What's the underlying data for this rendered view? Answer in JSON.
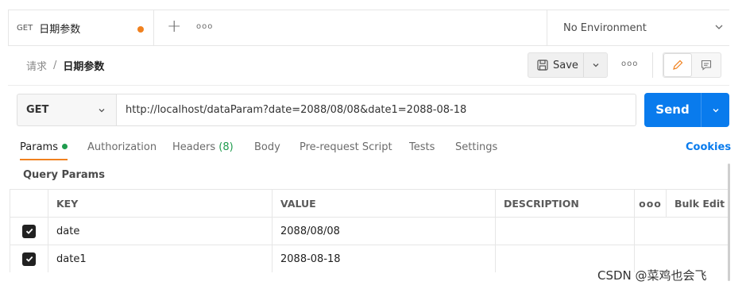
{
  "tab": {
    "method": "GET",
    "name": "日期参数"
  },
  "environment": {
    "label": "No Environment"
  },
  "breadcrumb": {
    "parent": "请求",
    "separator": "/",
    "current": "日期参数"
  },
  "toolbar": {
    "save_label": "Save"
  },
  "request": {
    "method": "GET",
    "url": "http://localhost/dataParam?date=2088/08/08&date1=2088-08-18",
    "send_label": "Send"
  },
  "req_tabs": {
    "params": "Params",
    "authorization": "Authorization",
    "headers": "Headers",
    "headers_count": "(8)",
    "body": "Body",
    "prerequest": "Pre-request Script",
    "tests": "Tests",
    "settings": "Settings",
    "cookies": "Cookies"
  },
  "query_params": {
    "title": "Query Params",
    "headers": {
      "key": "KEY",
      "value": "VALUE",
      "description": "DESCRIPTION",
      "bulk_edit": "Bulk Edit"
    },
    "rows": [
      {
        "checked": true,
        "key": "date",
        "value": "2088/08/08",
        "description": ""
      },
      {
        "checked": true,
        "key": "date1",
        "value": "2088-08-18",
        "description": ""
      }
    ]
  },
  "watermark": "CSDN @菜鸡也会飞",
  "colors": {
    "accent_orange": "#f0811f",
    "send_blue": "#097bed",
    "params_green": "#1f9c4e"
  }
}
